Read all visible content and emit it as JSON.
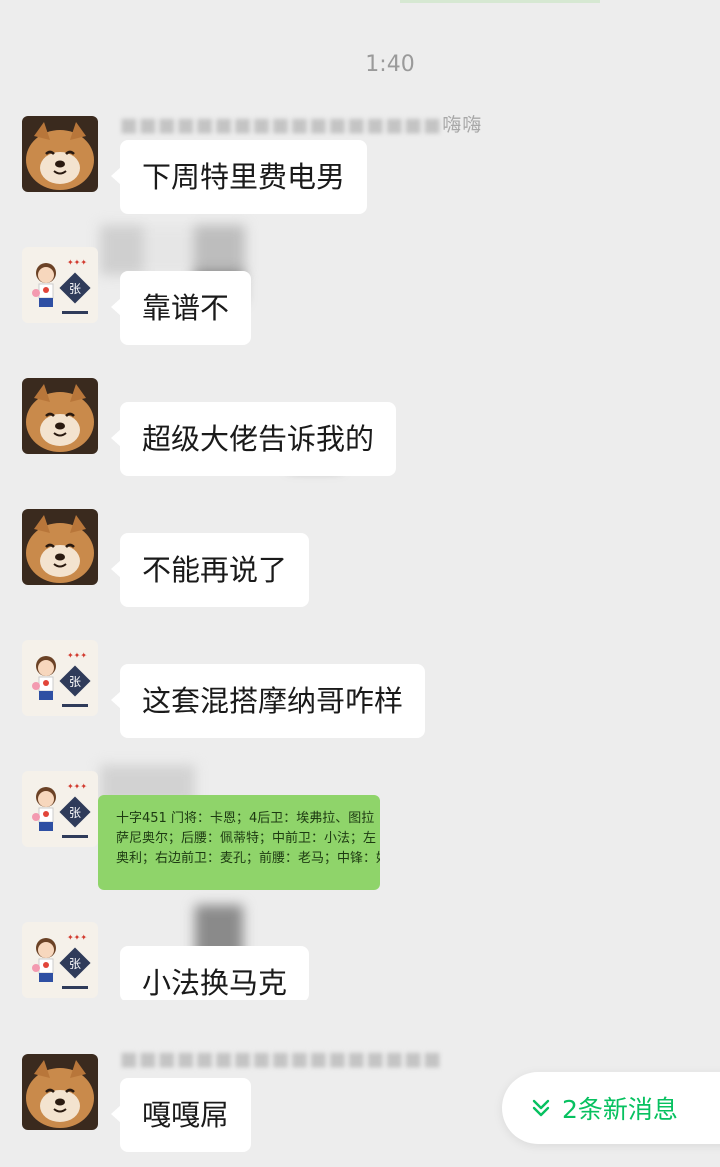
{
  "timestamp": "1:40",
  "senders": [
    {
      "name": "嗨嗨"
    },
    {
      "name": ""
    }
  ],
  "messages": [
    {
      "text": "下周特里费电男"
    },
    {
      "text": "靠谱不"
    },
    {
      "text": "超级大佬告诉我的"
    },
    {
      "text": "不能再说了"
    },
    {
      "text": "这套混搭摩纳哥咋样"
    },
    {
      "image_lines": [
        "十字451  门将：卡恩；4后卫：埃弗拉、图拉",
        "萨尼奥尔；后腰：佩蒂特；中前卫：小法；左",
        "奥利；右边前卫：麦孔；前腰：老马；中锋：好"
      ]
    },
    {
      "text": "小法换马克"
    },
    {
      "text": "嘎嘎屌"
    }
  ],
  "new_messages_button": {
    "label": "2条新消息",
    "icon": "double-chevron-down-icon"
  },
  "avatars": {
    "shiba": "shiba-dog-avatar",
    "cartoon": "cartoon-boy-avatar"
  },
  "colors": {
    "accent": "#07c160",
    "background": "#ededed",
    "bubble": "#ffffff",
    "image_bubble": "#8fd46a"
  }
}
